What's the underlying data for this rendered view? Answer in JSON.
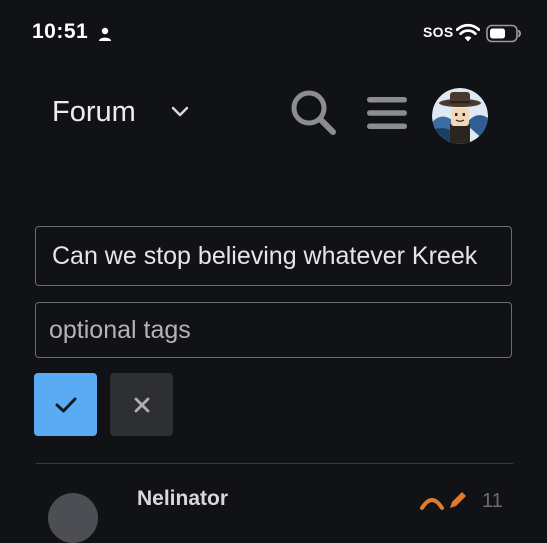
{
  "status_bar": {
    "time": "10:51",
    "sos": "SOS",
    "icons": [
      "person-icon",
      "wifi-icon",
      "battery-icon"
    ]
  },
  "header": {
    "title": "Forum",
    "icons": [
      "chevron-down-icon",
      "search-icon",
      "hamburger-menu-icon",
      "user-avatar"
    ]
  },
  "composer": {
    "title_value": "Can we stop believing whatever Kreek",
    "tags_placeholder": "optional tags",
    "confirm_icon": "checkmark-icon",
    "cancel_icon": "close-icon"
  },
  "post": {
    "username": "Nelinator",
    "meta": "11"
  },
  "colors": {
    "background": "#111216",
    "accent": "#5aabf4",
    "secondary_button": "#2e2f33",
    "border": "#6a6c72",
    "icon": "#8c8d92"
  }
}
